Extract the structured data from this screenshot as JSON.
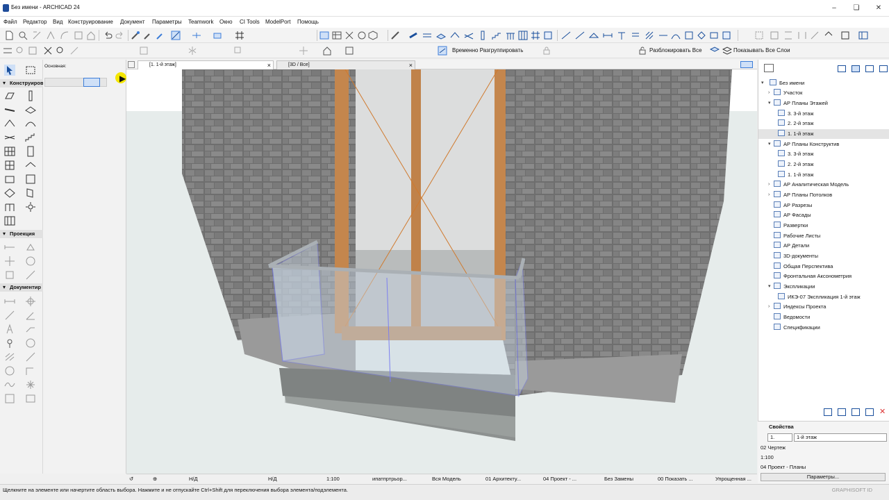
{
  "window": {
    "title": "Без имени - ARCHICAD 24"
  },
  "menu": [
    "Файл",
    "Редактор",
    "Вид",
    "Конструирование",
    "Документ",
    "Параметры",
    "Teamwork",
    "Окно",
    "CI Tools",
    "ModelPort",
    "Помощь"
  ],
  "toolbar2": {
    "regroup_label": "Временно Разгруппировать",
    "unlock_label": "Разблокировать Все",
    "show_layers_label": "Показывать Все Слои"
  },
  "toolbox": {
    "options_label": "Основная:",
    "section_construct": "Конструиров",
    "section_projection": "Проекция",
    "section_document": "Документир"
  },
  "tabs": [
    {
      "label": "[1. 1-й этаж]"
    },
    {
      "label": "[3D / Все]"
    }
  ],
  "navigator": {
    "root": "Без имени",
    "items": [
      {
        "label": "Участок"
      },
      {
        "label": "АР Планы Этажей"
      },
      {
        "label": "3. 3-й этаж"
      },
      {
        "label": "2. 2-й этаж"
      },
      {
        "label": "1. 1-й этаж"
      },
      {
        "label": "АР Планы Конструктив"
      },
      {
        "label": "3. 3-й этаж"
      },
      {
        "label": "2. 2-й этаж"
      },
      {
        "label": "1. 1-й этаж"
      },
      {
        "label": "АР Аналитическая Модель"
      },
      {
        "label": "АР Планы Потолков"
      },
      {
        "label": "АР Разрезы"
      },
      {
        "label": "АР Фасады"
      },
      {
        "label": "Развертки"
      },
      {
        "label": "Рабочие Листы"
      },
      {
        "label": "АР Детали"
      },
      {
        "label": "3D-документы"
      },
      {
        "label": "Общая Перспектива"
      },
      {
        "label": "Фронтальная Аксонометрия"
      },
      {
        "label": "Экспликации"
      },
      {
        "label": "ИКЭ-07 Экспликация 1-й этаж"
      },
      {
        "label": "Индексы Проекта"
      },
      {
        "label": "Ведомости"
      },
      {
        "label": "Спецификации"
      }
    ]
  },
  "properties": {
    "header": "Свойства",
    "id_value": "1.",
    "name_value": "1-й этаж",
    "layer": "02 Чертеж",
    "scale": "1:100",
    "project": "04 Проект - Планы",
    "params_button": "Параметры..."
  },
  "statusbar": {
    "nd1": "Н/Д",
    "nd2": "Н/Д",
    "scale": "1:100",
    "pen_set": "ипатпртрьор...",
    "model": "Вся Модель",
    "layer_combo": "01 Архитекту...",
    "view": "04 Проект - ...",
    "overrides": "Без Замены",
    "show": "00 Показать ...",
    "simplified": "Упрощенная ..."
  },
  "hint": "Щелкните на элементе или начертите область выбора. Нажмите и не отпускайте Ctrl+Shift для переключения выбора элемента/подэлемента.",
  "watermark": "GRAPHISOFT ID",
  "colors": {
    "accent": "#3c7dd8",
    "selection": "#7b7ff0",
    "frame": "#d07a2e"
  }
}
